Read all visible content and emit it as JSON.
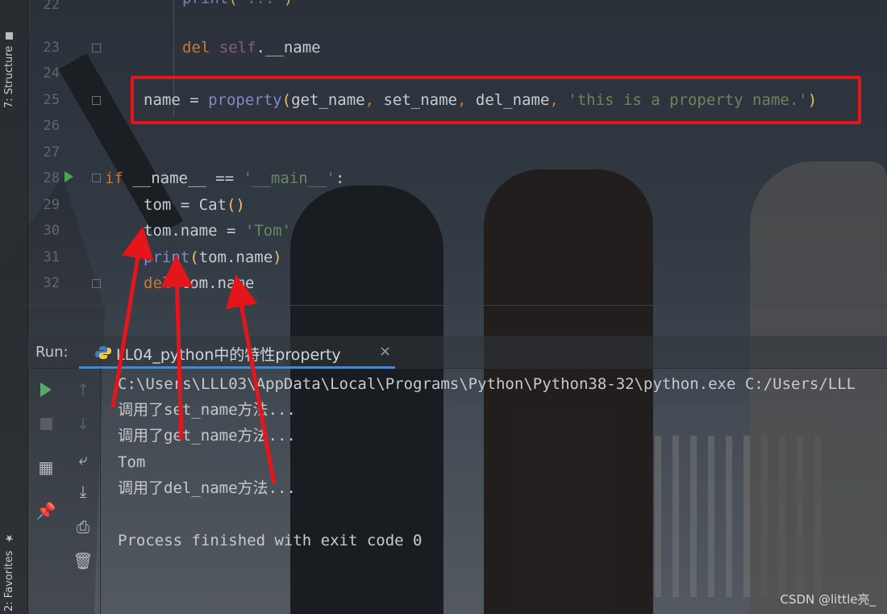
{
  "left_toolbar": {
    "structure_tab": "7: Structure",
    "favorites_tab": "2: Favorites"
  },
  "editor": {
    "line_numbers": [
      "22",
      "23",
      "24",
      "25",
      "26",
      "27",
      "28",
      "29",
      "30",
      "31",
      "32"
    ],
    "line_23": {
      "kw": "del",
      "self": "self",
      "rest": ".__name"
    },
    "line_25": {
      "name": "name",
      "eq": " = ",
      "fn": "property",
      "open": "(",
      "a1": "get_name",
      "c1": ", ",
      "a2": "set_name",
      "c2": ", ",
      "a3": "del_name",
      "c3": ", ",
      "doc": "'this is a property name.'",
      "close": ")"
    },
    "line_28": {
      "kw": "if",
      "mid": " __name__ == ",
      "str": "'__main__'",
      "end": ":"
    },
    "line_29": {
      "lhs": "tom = Cat",
      "parens": "()"
    },
    "line_30": {
      "lhs": "tom.name = ",
      "str": "'Tom'"
    },
    "line_31": {
      "fn": "print",
      "open": "(",
      "arg": "tom.name",
      "close": ")"
    },
    "line_32": {
      "kw": "del",
      "rest": " tom.name"
    },
    "highlight_color": "#e5161b"
  },
  "run_panel": {
    "title": "Run:",
    "tab_label": "LL04_python中的特性property",
    "close_icon": "×"
  },
  "console": {
    "lines": [
      "C:\\Users\\LLL03\\AppData\\Local\\Programs\\Python\\Python38-32\\python.exe C:/Users/LLL",
      "调用了set_name方法...",
      "调用了get_name方法...",
      "Tom",
      "调用了del_name方法...",
      "",
      "Process finished with exit code 0"
    ]
  },
  "watermark": "CSDN @little亮_",
  "icons": {
    "run": "play-icon",
    "stop": "stop-icon",
    "up": "arrow-up-icon",
    "down": "arrow-down-icon",
    "layout": "layout-icon",
    "wrap": "soft-wrap-icon",
    "pin": "pin-icon",
    "scroll": "scroll-to-end-icon",
    "print": "print-icon",
    "trash": "trash-icon"
  }
}
